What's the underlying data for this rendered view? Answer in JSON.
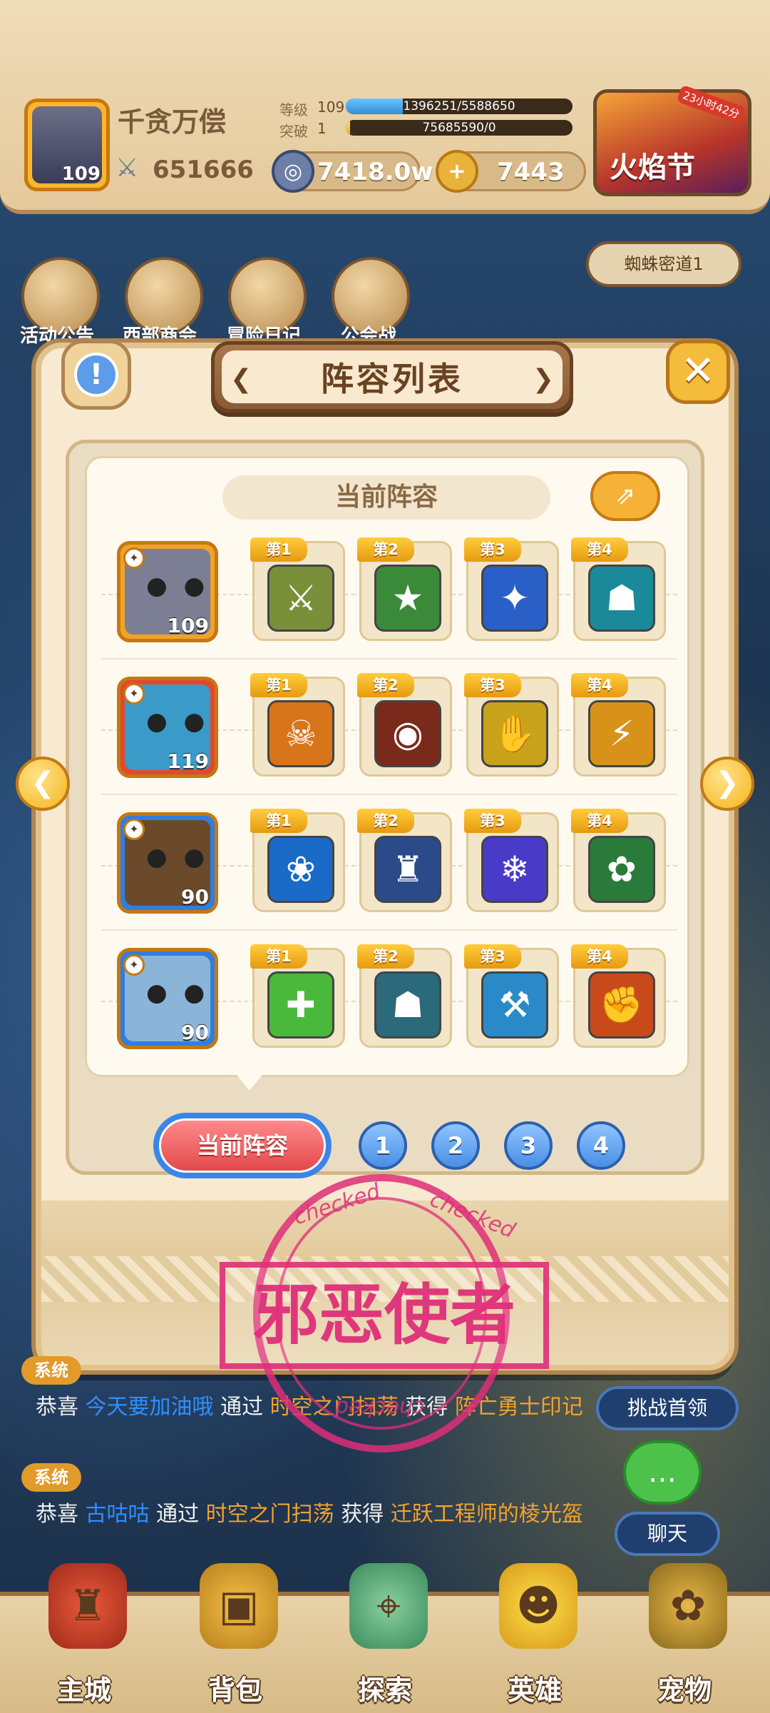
{
  "player": {
    "name": "千贪万偿",
    "level": "109",
    "power": "651666",
    "level_label": "等级",
    "level_value": "109",
    "exp_text": "1396251/5588650",
    "exp_progress": 0.25,
    "break_label": "突破",
    "break_value": "1",
    "break_text": "75685590/0",
    "break_progress": 0.02
  },
  "currency": {
    "silver": "7418.0w",
    "gold": "7443"
  },
  "festival": {
    "label": "火焰节",
    "timer": "23小时42分"
  },
  "side_menu": [
    {
      "label": "活动公告",
      "icon": "notice-icon"
    },
    {
      "label": "西部商会",
      "icon": "merchant-icon"
    },
    {
      "label": "冒险日记",
      "icon": "diary-icon"
    },
    {
      "label": "公会战",
      "icon": "guild-war-icon"
    }
  ],
  "region": "蜘蛛密道1",
  "modal": {
    "title": "阵容列表",
    "current_label": "当前阵容",
    "rows": [
      {
        "hero_level": "109",
        "hero_color": "#7c7e94",
        "frame_color": "#f1a328",
        "skills": [
          {
            "tag": "第1",
            "color": "#7a8f3a",
            "glyph": "⚔"
          },
          {
            "tag": "第2",
            "color": "#3a8a3a",
            "glyph": "★"
          },
          {
            "tag": "第3",
            "color": "#2a5fc8",
            "glyph": "✦"
          },
          {
            "tag": "第4",
            "color": "#1a8a9a",
            "glyph": "☗"
          }
        ]
      },
      {
        "hero_level": "119",
        "hero_color": "#3a9ac8",
        "frame_color": "#e2492c",
        "skills": [
          {
            "tag": "第1",
            "color": "#d8741a",
            "glyph": "☠"
          },
          {
            "tag": "第2",
            "color": "#7a2a1a",
            "glyph": "◉"
          },
          {
            "tag": "第3",
            "color": "#c8a21a",
            "glyph": "✋"
          },
          {
            "tag": "第4",
            "color": "#d8921a",
            "glyph": "⚡"
          }
        ]
      },
      {
        "hero_level": "90",
        "hero_color": "#6a4a2a",
        "frame_color": "#2f7ee0",
        "skills": [
          {
            "tag": "第1",
            "color": "#1a6ac8",
            "glyph": "❀"
          },
          {
            "tag": "第2",
            "color": "#2a4a8a",
            "glyph": "♜"
          },
          {
            "tag": "第3",
            "color": "#4a3ac8",
            "glyph": "❄"
          },
          {
            "tag": "第4",
            "color": "#2a7a3a",
            "glyph": "✿"
          }
        ]
      },
      {
        "hero_level": "90",
        "hero_color": "#8ab4d8",
        "frame_color": "#2f7ee0",
        "skills": [
          {
            "tag": "第1",
            "color": "#4ab83a",
            "glyph": "✚"
          },
          {
            "tag": "第2",
            "color": "#2a6a7a",
            "glyph": "☗"
          },
          {
            "tag": "第3",
            "color": "#2a8ac8",
            "glyph": "⚒"
          },
          {
            "tag": "第4",
            "color": "#c84a1a",
            "glyph": "✊"
          }
        ]
      }
    ],
    "pager": {
      "current": "当前阵容",
      "pages": [
        "1",
        "2",
        "3",
        "4"
      ]
    }
  },
  "stamp": {
    "text": "邪恶使者",
    "word": "checked"
  },
  "chat": {
    "tag": "系统",
    "messages": [
      {
        "prefix": "恭喜",
        "user": "今天要加油哦",
        "mid": "通过",
        "source": "时空之门扫荡",
        "get": "获得",
        "item": "阵亡勇士印记"
      },
      {
        "prefix": "恭喜",
        "user": "古咕咕",
        "mid": "通过",
        "source": "时空之门扫荡",
        "get": "获得",
        "item": "迁跃工程师的棱光盔"
      }
    ]
  },
  "side_buttons": {
    "challenge": "挑战首领",
    "chat": "聊天"
  },
  "tabs": [
    {
      "label": "主城"
    },
    {
      "label": "背包"
    },
    {
      "label": "探索"
    },
    {
      "label": "英雄"
    },
    {
      "label": "宠物"
    }
  ]
}
